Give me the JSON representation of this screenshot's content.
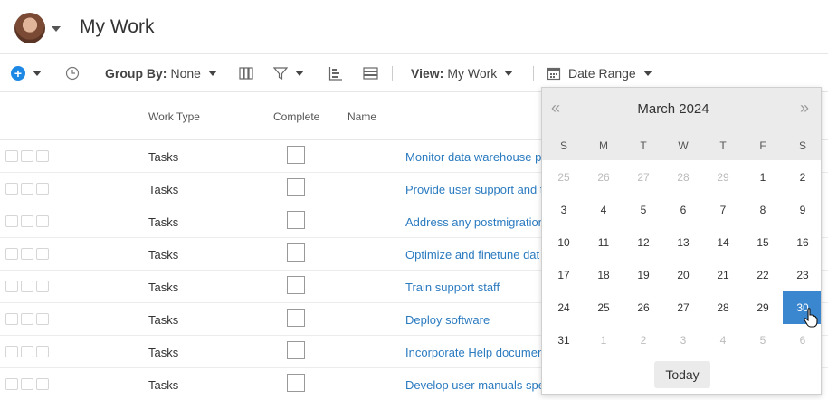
{
  "header": {
    "title": "My Work"
  },
  "toolbar": {
    "group_by_label": "Group By:",
    "group_by_value": "None",
    "view_label": "View:",
    "view_value": "My Work",
    "date_range_label": "Date Range"
  },
  "table": {
    "columns": [
      "Work Type",
      "Complete",
      "Name"
    ],
    "rows": [
      {
        "type": "Tasks",
        "name": "Monitor data warehouse p"
      },
      {
        "type": "Tasks",
        "name": "Provide user support and t"
      },
      {
        "type": "Tasks",
        "name": "Address any postmigration"
      },
      {
        "type": "Tasks",
        "name": "Optimize and finetune dat"
      },
      {
        "type": "Tasks",
        "name": "Train support staff"
      },
      {
        "type": "Tasks",
        "name": "Deploy software"
      },
      {
        "type": "Tasks",
        "name": "Incorporate Help documen"
      },
      {
        "type": "Tasks",
        "name": "Develop user manuals spe"
      }
    ]
  },
  "calendar": {
    "month_label": "March 2024",
    "prev_icon": "«",
    "next_icon": "»",
    "weekdays": [
      "S",
      "M",
      "T",
      "W",
      "T",
      "F",
      "S"
    ],
    "weeks": [
      [
        "25",
        "26",
        "27",
        "28",
        "29",
        "1",
        "2"
      ],
      [
        "3",
        "4",
        "5",
        "6",
        "7",
        "8",
        "9"
      ],
      [
        "10",
        "11",
        "12",
        "13",
        "14",
        "15",
        "16"
      ],
      [
        "17",
        "18",
        "19",
        "20",
        "21",
        "22",
        "23"
      ],
      [
        "24",
        "25",
        "26",
        "27",
        "28",
        "29",
        "30"
      ],
      [
        "31",
        "1",
        "2",
        "3",
        "4",
        "5",
        "6"
      ]
    ],
    "selected_day": "30",
    "today_label": "Today",
    "accent_color": "#3b87cf"
  }
}
